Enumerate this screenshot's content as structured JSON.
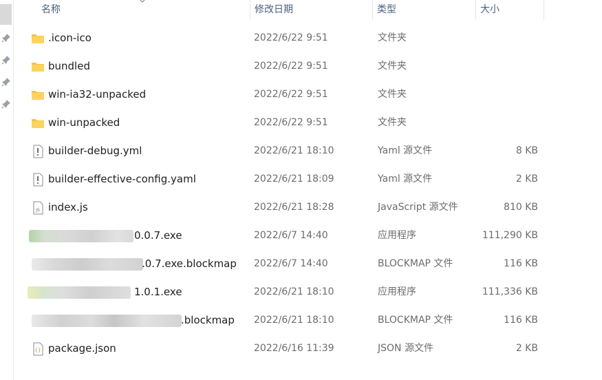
{
  "columns": {
    "name": "名称",
    "date": "修改日期",
    "type": "类型",
    "size": "大小"
  },
  "files": [
    {
      "icon": "folder-icon",
      "name": ".icon-ico",
      "date": "2022/6/22 9:51",
      "type": "文件夹",
      "size": ""
    },
    {
      "icon": "folder-icon",
      "name": "bundled",
      "date": "2022/6/22 9:51",
      "type": "文件夹",
      "size": ""
    },
    {
      "icon": "folder-icon",
      "name": "win-ia32-unpacked",
      "date": "2022/6/22 9:51",
      "type": "文件夹",
      "size": ""
    },
    {
      "icon": "folder-icon",
      "name": "win-unpacked",
      "date": "2022/6/22 9:51",
      "type": "文件夹",
      "size": ""
    },
    {
      "icon": "yaml-file-icon",
      "name": "builder-debug.yml",
      "date": "2022/6/21 18:10",
      "type": "Yaml 源文件",
      "size": "8 KB"
    },
    {
      "icon": "yaml-file-icon",
      "name": "builder-effective-config.yaml",
      "date": "2022/6/21 18:09",
      "type": "Yaml 源文件",
      "size": "2 KB"
    },
    {
      "icon": "js-file-icon",
      "name": "index.js",
      "date": "2022/6/21 18:28",
      "type": "JavaScript 源文件",
      "size": "810 KB"
    },
    {
      "icon": "app-icon",
      "name": "0.0.7.exe",
      "date": "2022/6/7 14:40",
      "type": "应用程序",
      "size": "111,290 KB"
    },
    {
      "icon": "file-icon",
      "name": ".0.7.exe.blockmap",
      "date": "2022/6/7 14:40",
      "type": "BLOCKMAP 文件",
      "size": "116 KB"
    },
    {
      "icon": "app-icon",
      "name": "1.0.1.exe",
      "date": "2022/6/21 18:10",
      "type": "应用程序",
      "size": "111,336 KB"
    },
    {
      "icon": "file-icon",
      "name": ".blockmap",
      "date": "2022/6/21 18:10",
      "type": "BLOCKMAP 文件",
      "size": "116 KB"
    },
    {
      "icon": "json-file-icon",
      "name": "package.json",
      "date": "2022/6/16 11:39",
      "type": "JSON 源文件",
      "size": "2 KB"
    }
  ]
}
